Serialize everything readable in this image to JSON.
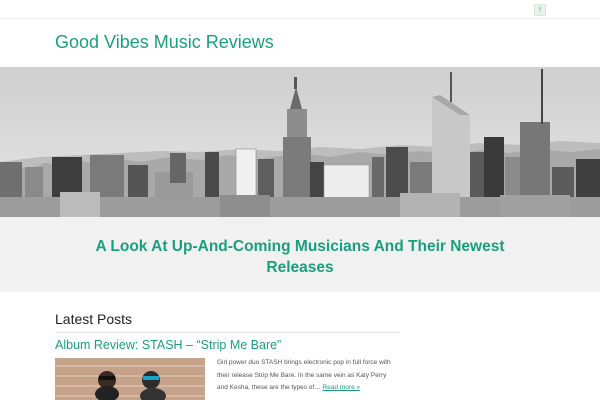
{
  "header": {
    "social_icon": "facebook-icon",
    "social_glyph": "f",
    "site_title": "Good Vibes Music Reviews"
  },
  "hero": {
    "image": "city-skyline-grayscale"
  },
  "tagline": "A Look At Up-And-Coming Musicians And Their Newest Releases",
  "latest": {
    "heading": "Latest Posts",
    "posts": [
      {
        "title": "Album Review: STASH – “Strip Me Bare”",
        "excerpt": "Girl power duo STASH brings electronic pop in full force with their release Strip Me Bare. In the same vein as Katy Perry and Kesha, these are the types of…",
        "read_more": "Read more »"
      }
    ]
  },
  "colors": {
    "accent": "#1a9f7e",
    "band": "#f1f1f1"
  }
}
